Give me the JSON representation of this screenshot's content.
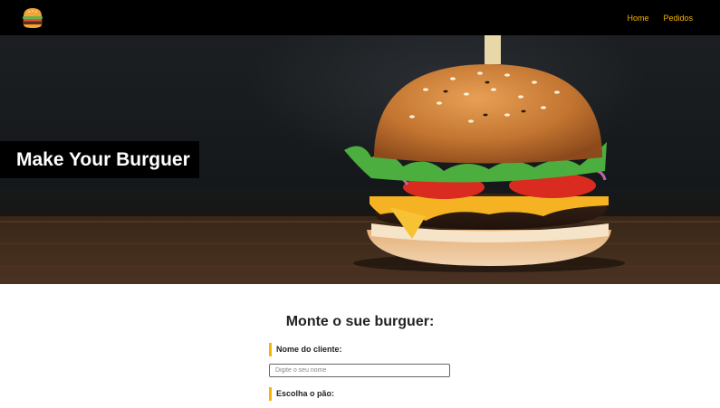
{
  "nav": {
    "logo_icon": "burger-logo-icon",
    "links": [
      {
        "label": "Home"
      },
      {
        "label": "Pedidos"
      }
    ],
    "link_color": "#f8b400"
  },
  "hero": {
    "title": "Make Your Burguer",
    "image": "burger-photo"
  },
  "form": {
    "title": "Monte o sue burguer:",
    "name_label": "Nome do cliente:",
    "name_value": "",
    "name_placeholder": "Digite o seu nome",
    "bread_label": "Escolha o pão:",
    "accent_color": "#f8b400"
  }
}
